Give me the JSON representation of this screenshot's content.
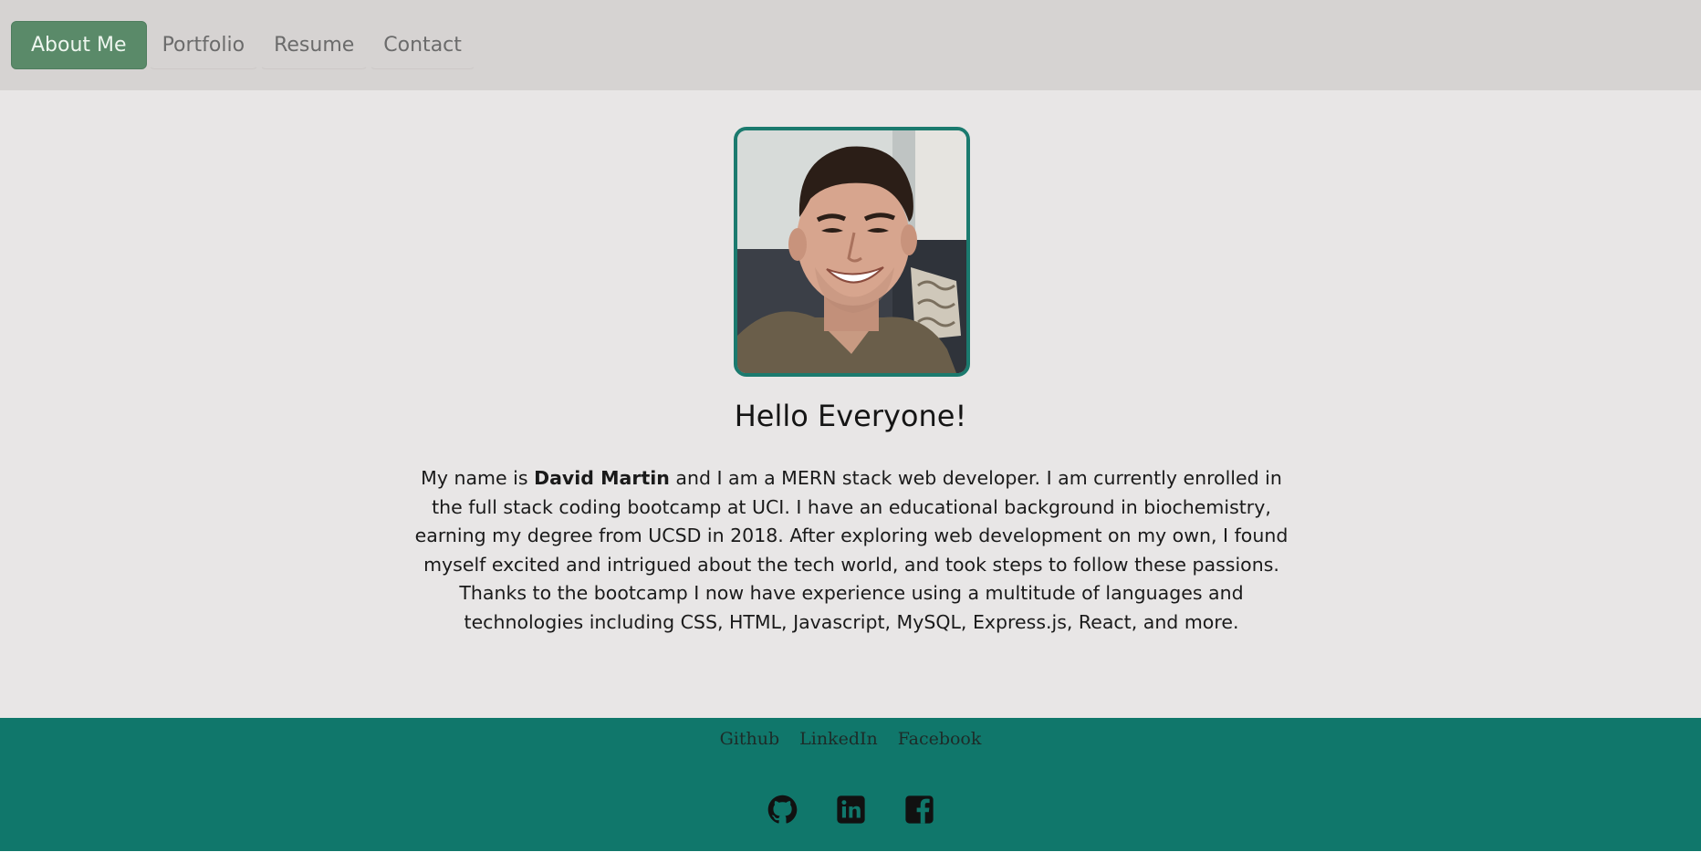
{
  "nav": {
    "items": [
      {
        "label": "About Me",
        "active": true
      },
      {
        "label": "Portfolio",
        "active": false
      },
      {
        "label": "Resume",
        "active": false
      },
      {
        "label": "Contact",
        "active": false
      }
    ]
  },
  "main": {
    "avatar_alt": "profile photo",
    "greeting": "Hello Everyone!",
    "bio": {
      "prefix": "My name is ",
      "name": "David Martin",
      "rest": " and I am a MERN stack web developer. I am currently enrolled in the full stack coding bootcamp at UCI. I have an educational background in biochemistry, earning my degree from UCSD in 2018. After exploring web development on my own, I found myself excited and intrigued about the tech world, and took steps to follow these passions. Thanks to the bootcamp I now have experience using a multitude of languages and technologies including CSS, HTML, Javascript, MySQL, Express.js, React, and more."
    }
  },
  "footer": {
    "links": [
      "Github",
      "LinkedIn",
      "Facebook"
    ],
    "icons": [
      "github-icon",
      "linkedin-icon",
      "facebook-icon"
    ]
  },
  "colors": {
    "nav_bg": "#d6d3d2",
    "active_nav": "#5a8a69",
    "main_bg": "#e8e6e6",
    "accent": "#1b7a6e",
    "footer_bg": "#10776b"
  }
}
